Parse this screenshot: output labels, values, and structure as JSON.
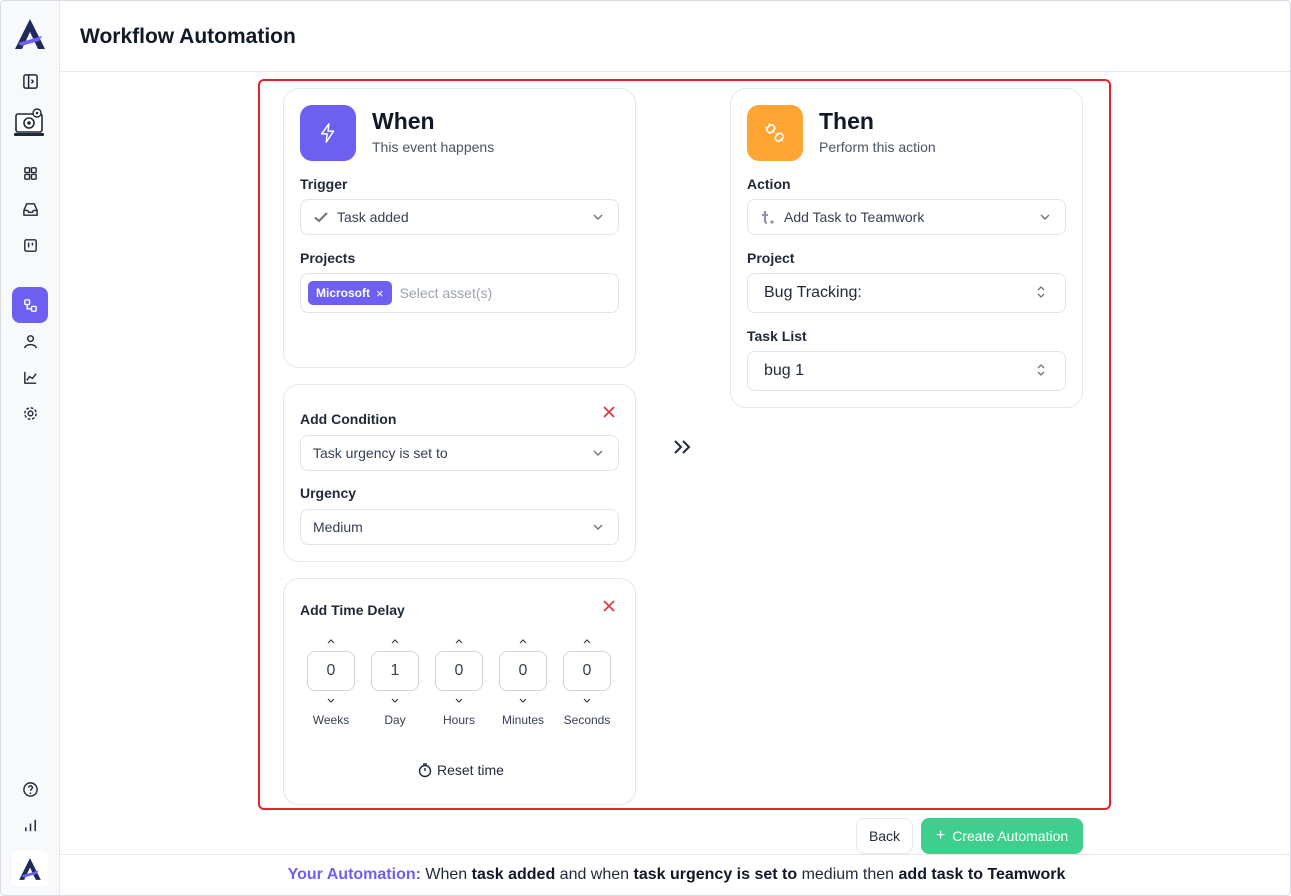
{
  "page": {
    "title": "Workflow Automation"
  },
  "colors": {
    "accent": "#6d5ff0",
    "orange": "#ffa534",
    "green": "#3ecf8e",
    "danger": "#e3242b"
  },
  "sidebar": {
    "icons": [
      "logo-icon",
      "collapse-sidebar-icon",
      "workstation-settings-icon",
      "dashboard-icon",
      "inbox-icon",
      "board-icon",
      "workflow-icon",
      "user-icon",
      "analytics-icon",
      "settings-icon",
      "help-icon",
      "bar-chart-icon"
    ]
  },
  "when": {
    "title": "When",
    "subtitle": "This event happens",
    "trigger_label": "Trigger",
    "trigger_value": "Task added",
    "projects_label": "Projects",
    "projects_chip": "Microsoft",
    "projects_placeholder": "Select asset(s)"
  },
  "condition": {
    "title": "Add Condition",
    "value": "Task urgency is set to",
    "urgency_label": "Urgency",
    "urgency_value": "Medium"
  },
  "delay": {
    "title": "Add Time Delay",
    "fields": [
      {
        "value": "0",
        "label": "Weeks"
      },
      {
        "value": "1",
        "label": "Day"
      },
      {
        "value": "0",
        "label": "Hours"
      },
      {
        "value": "0",
        "label": "Minutes"
      },
      {
        "value": "0",
        "label": "Seconds"
      }
    ],
    "reset_label": "Reset time"
  },
  "then": {
    "title": "Then",
    "subtitle": "Perform this action",
    "action_label": "Action",
    "action_value": "Add Task to Teamwork",
    "project_label": "Project",
    "project_value": "Bug Tracking:",
    "tasklist_label": "Task List",
    "tasklist_value": "bug 1"
  },
  "footer": {
    "back_label": "Back",
    "create_label": "Create Automation",
    "create_icon": "+"
  },
  "summary": {
    "prefix": "Your Automation:",
    "t1": " When ",
    "b1": "task added",
    "t2": " and when ",
    "b2": "task urgency is set to",
    "t3": " medium then ",
    "b3": "add task to Teamwork"
  }
}
